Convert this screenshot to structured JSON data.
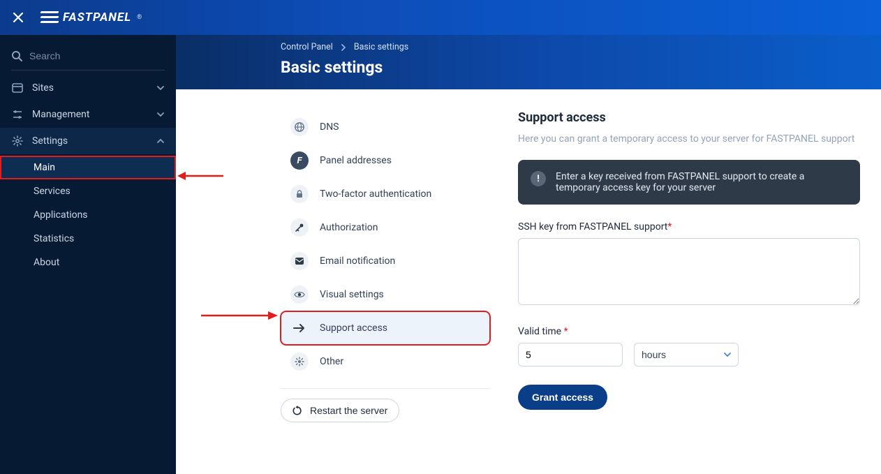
{
  "brand": {
    "name": "FASTPANEL",
    "registered": "®"
  },
  "sidebar": {
    "search_placeholder": "Search",
    "items": [
      {
        "label": "Sites",
        "icon": "sites"
      },
      {
        "label": "Management",
        "icon": "management"
      },
      {
        "label": "Settings",
        "icon": "settings",
        "expanded": true
      }
    ],
    "settings_sub": [
      {
        "label": "Main",
        "selected": true
      },
      {
        "label": "Services"
      },
      {
        "label": "Applications"
      },
      {
        "label": "Statistics"
      },
      {
        "label": "About"
      }
    ]
  },
  "breadcrumb": {
    "root": "Control Panel",
    "current": "Basic settings"
  },
  "page": {
    "title": "Basic settings"
  },
  "tabs": [
    {
      "label": "DNS",
      "icon": "globe-icon"
    },
    {
      "label": "Panel addresses",
      "icon": "panel-icon"
    },
    {
      "label": "Two-factor authentication",
      "icon": "lock-icon"
    },
    {
      "label": "Authorization",
      "icon": "key-icon"
    },
    {
      "label": "Email notification",
      "icon": "mail-icon"
    },
    {
      "label": "Visual settings",
      "icon": "eye-icon"
    },
    {
      "label": "Support access",
      "icon": "arrow-right-icon",
      "active": true
    },
    {
      "label": "Other",
      "icon": "gear-icon"
    }
  ],
  "restart_label": "Restart the server",
  "support": {
    "title": "Support access",
    "description": "Here you can grant a temporary access to your server for FASTPANEL support",
    "info": "Enter a key received from FASTPANEL support to create a temporary access key for your server",
    "ssh_label": "SSH key from FASTPANEL support",
    "ssh_value": "",
    "valid_label": "Valid time",
    "valid_value": "5",
    "valid_unit": "hours",
    "valid_unit_options": [
      "hours"
    ],
    "grant_label": "Grant access"
  }
}
